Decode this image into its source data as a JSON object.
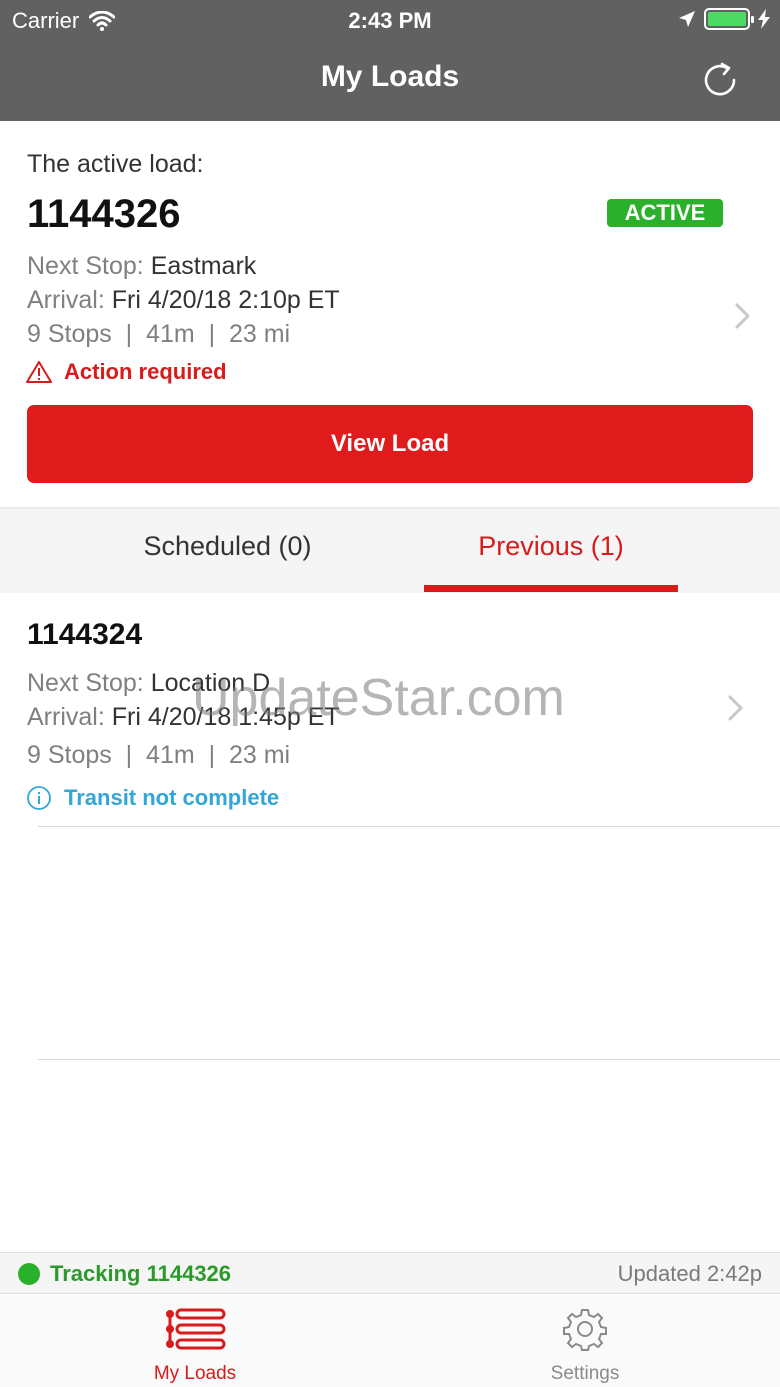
{
  "status_bar": {
    "carrier": "Carrier",
    "time": "2:43 PM"
  },
  "header": {
    "title": "My Loads"
  },
  "active_load": {
    "label": "The active load:",
    "id": "1144326",
    "status": "ACTIVE",
    "next_stop_label": "Next Stop:",
    "next_stop": "Eastmark",
    "arrival_label": "Arrival:",
    "arrival": "Fri 4/20/18 2:10p ET",
    "summary": "9 Stops  |  41m  |  23 mi",
    "alert": "Action required",
    "button_label": "View Load"
  },
  "tabs": [
    {
      "label": "Scheduled (0)",
      "active": false
    },
    {
      "label": "Previous (1)",
      "active": true
    }
  ],
  "previous_loads": [
    {
      "id": "1144324",
      "next_stop_label": "Next Stop:",
      "next_stop": "Location D",
      "arrival_label": "Arrival:",
      "arrival": "Fri 4/20/18 1:45p ET",
      "summary": "9 Stops  |  41m  |  23 mi",
      "info": "Transit not complete"
    }
  ],
  "watermark": "UpdateStar.com",
  "tracking": {
    "label": "Tracking 1144326",
    "updated": "Updated 2:42p"
  },
  "tabbar": [
    {
      "label": "My Loads",
      "icon": "list-icon",
      "active": true
    },
    {
      "label": "Settings",
      "icon": "gear-icon",
      "active": false
    }
  ],
  "colors": {
    "accent": "#d81b1b",
    "header": "#616161",
    "active_green": "#2ab02a",
    "info_blue": "#31a6d8"
  }
}
